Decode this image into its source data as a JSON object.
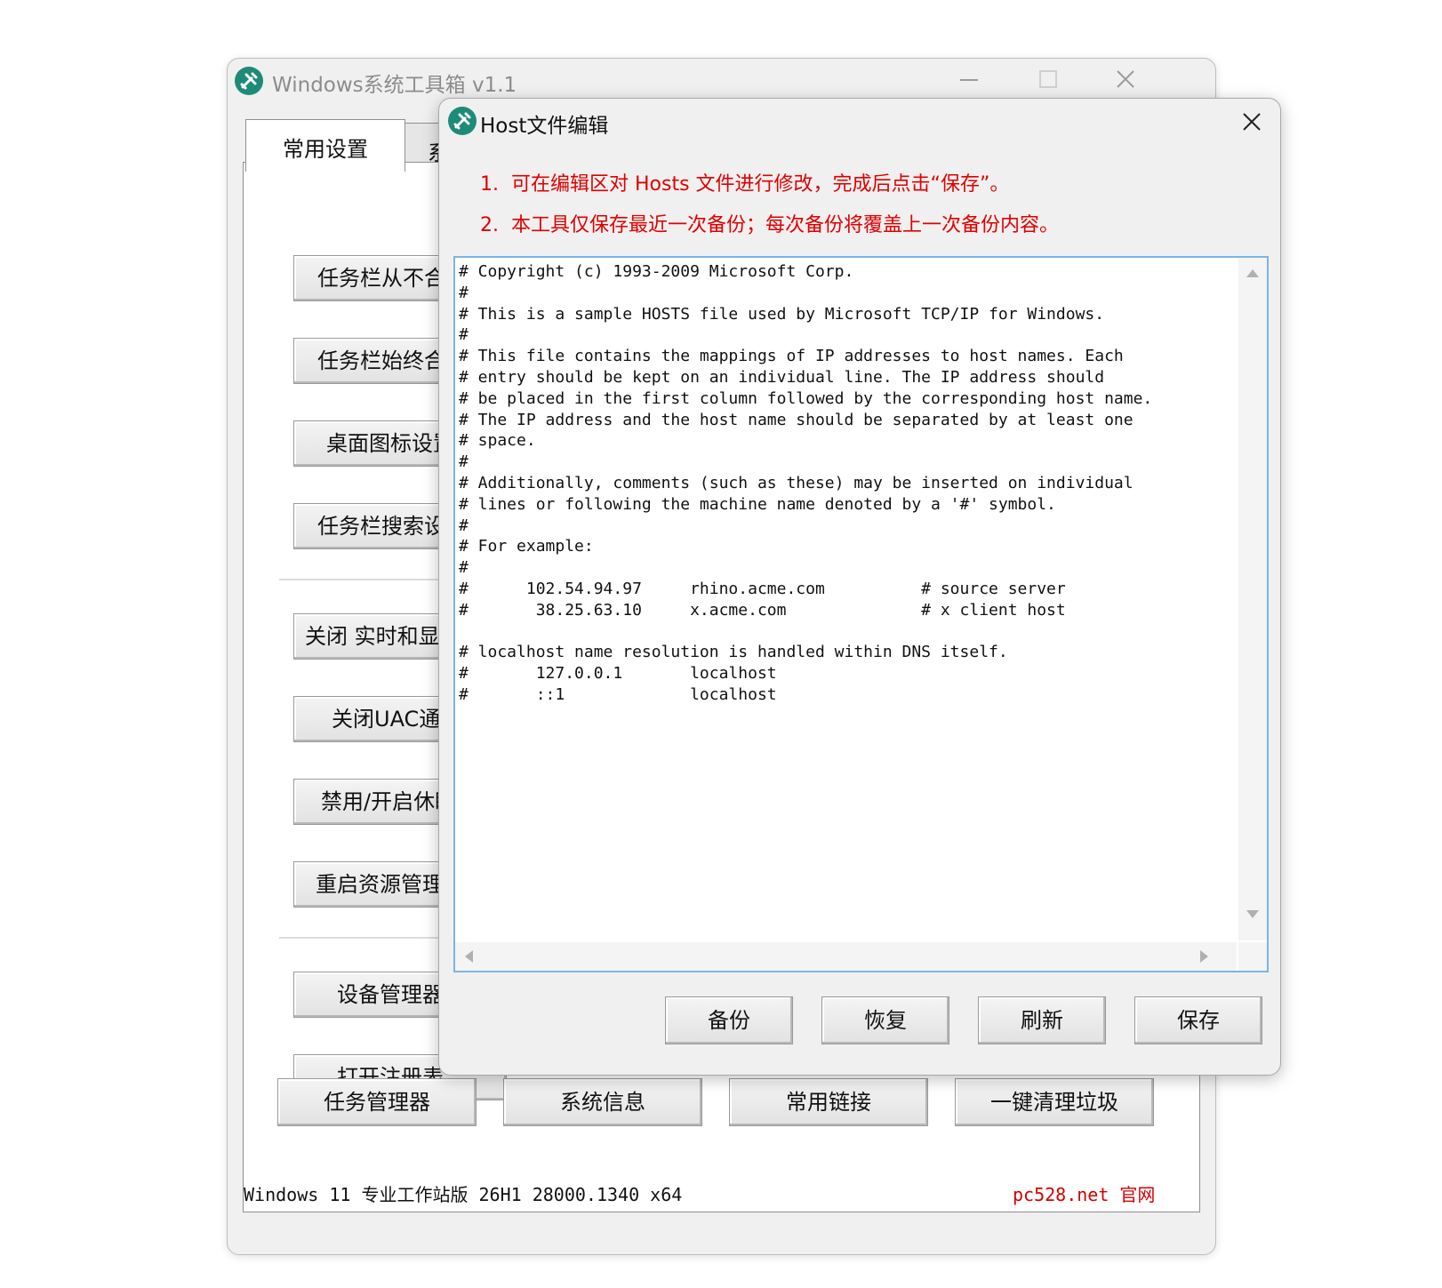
{
  "main_window": {
    "title": "Windows系统工具箱 v1.1",
    "tabs": [
      {
        "label": "常用设置"
      },
      {
        "label": "系"
      }
    ],
    "left_buttons": [
      {
        "label": "任务栏从不合并"
      },
      {
        "label": "任务栏始终合并"
      },
      {
        "label": "桌面图标设置"
      },
      {
        "label": "任务栏搜索设置"
      },
      {
        "label": "关闭 实时和显改"
      },
      {
        "label": "关闭UAC通知"
      },
      {
        "label": "禁用/开启休眠"
      },
      {
        "label": "重启资源管理器"
      },
      {
        "label": "设备管理器"
      },
      {
        "label": "打开注册表"
      }
    ],
    "bottom_buttons": [
      {
        "label": "任务管理器"
      },
      {
        "label": "系统信息"
      },
      {
        "label": "常用链接"
      },
      {
        "label": "一键清理垃圾"
      }
    ],
    "status_left": "Windows 11 专业工作站版 26H1 28000.1340 x64",
    "status_right": "pc528.net 官网"
  },
  "dialog": {
    "title": "Host文件编辑",
    "notices": [
      {
        "num": "1.",
        "text": "可在编辑区对 Hosts 文件进行修改，完成后点击“保存”。"
      },
      {
        "num": "2.",
        "text": "本工具仅保存最近一次备份；每次备份将覆盖上一次备份内容。"
      }
    ],
    "hosts_content": "# Copyright (c) 1993-2009 Microsoft Corp.\n#\n# This is a sample HOSTS file used by Microsoft TCP/IP for Windows.\n#\n# This file contains the mappings of IP addresses to host names. Each\n# entry should be kept on an individual line. The IP address should\n# be placed in the first column followed by the corresponding host name.\n# The IP address and the host name should be separated by at least one\n# space.\n#\n# Additionally, comments (such as these) may be inserted on individual\n# lines or following the machine name denoted by a '#' symbol.\n#\n# For example:\n#\n#      102.54.94.97     rhino.acme.com          # source server\n#       38.25.63.10     x.acme.com              # x client host\n\n# localhost name resolution is handled within DNS itself.\n#\t127.0.0.1       localhost\n#\t::1             localhost",
    "buttons": {
      "backup": "备份",
      "restore": "恢复",
      "refresh": "刷新",
      "save": "保存"
    }
  },
  "colors": {
    "accent_red": "#e00000",
    "editor_border": "#7eb4e2",
    "icon_green": "#1e8a78"
  }
}
